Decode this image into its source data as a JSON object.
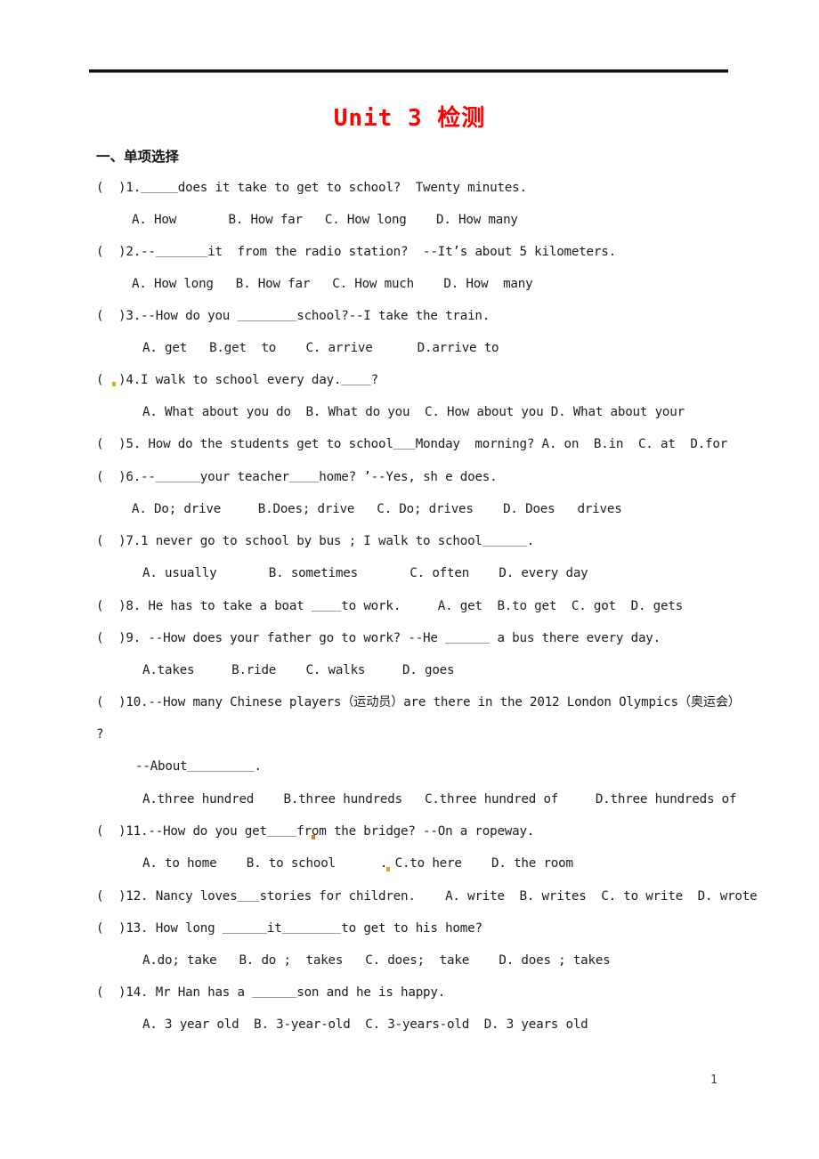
{
  "document": {
    "title": "Unit 3 检测",
    "title_color": "#ff0000",
    "page_number": "1",
    "section_heading": "一、单项选择"
  },
  "questions": [
    {
      "id": "q1",
      "stem": "（ ）1.＿＿＿does it take to get to school?  Twenty minutes.",
      "stem_prefix": "(  )1.",
      "stem_blank": "_____",
      "stem_rest": "does it take to get to school?  Twenty minutes.",
      "options_line": "A. How       B. How far   C. How long    D. How many"
    },
    {
      "id": "q2",
      "stem_prefix": "(  )2.--",
      "stem_blank": "_______",
      "stem_rest": "it  from the radio station?  --It’s about 5 kilometers.",
      "options_line": "A. How long   B. How far   C. How much    D. How  many"
    },
    {
      "id": "q3",
      "stem_prefix": "(  )3.--How do you ",
      "stem_blank": "________",
      "stem_rest": "school?--I take the train.",
      "options_line": "A. get   B.get  to    C. arrive      D.arrive to"
    },
    {
      "id": "q4",
      "stem_prefix": "(  )4.I walk to school every day.",
      "stem_blank": "____",
      "stem_rest": "?",
      "options_line": "A. What about you do  B. What do you  C. How about you D. What about your"
    },
    {
      "id": "q5",
      "stem_prefix": "(  )5. How do the students get to school",
      "stem_blank": "___",
      "stem_rest": "Monday  morning? A. on  B.in  C. at  D.for",
      "options_line": ""
    },
    {
      "id": "q6",
      "stem_prefix": "(  )6.--",
      "stem_blank": "______",
      "stem_rest": "your teacher",
      "stem_blank2": "____",
      "stem_rest2": "home? ’--Yes, sh e does.",
      "options_line": "A. Do; drive     B.Does; drive   C. Do; drives    D. Does   drives"
    },
    {
      "id": "q7",
      "stem_prefix": "(  )7.1 never go to school by bus ; I walk to school",
      "stem_blank": "______",
      "stem_rest": ".",
      "options_line": "A. usually       B. sometimes       C. often    D. every day"
    },
    {
      "id": "q8",
      "stem_prefix": "(  )8. He has to take a boat ",
      "stem_blank": "____",
      "stem_rest": "to work.     A. get  B.to get  C. got  D. gets",
      "options_line": ""
    },
    {
      "id": "q9",
      "stem_prefix": "(  )9. --How does your father go to work? --He ",
      "stem_blank": "______",
      "stem_rest": " a bus there every day.",
      "options_line": "A.takes     B.ride    C. walks     D. goes"
    },
    {
      "id": "q10",
      "stem_prefix": "(  )10.--How many Chinese players（运动员）are there in the 2012 London Olympics（奥运会）",
      "stem_blank": "",
      "stem_rest": "",
      "wrapped_line": "?",
      "answer_lead_prefix": "--About",
      "answer_lead_blank": "_________",
      "answer_lead_rest": ".",
      "options_line": "A.three hundred    B.three hundreds   C.three hundred of     D.three hundreds of"
    },
    {
      "id": "q11",
      "stem_prefix": "(  )11.--How do you get",
      "stem_blank": "____",
      "stem_rest": "from the bridge? --On a ropeway.",
      "options_line": "A. to home    B. to school      . C.to here    D. the room"
    },
    {
      "id": "q12",
      "stem_prefix": "(  )12. Nancy loves",
      "stem_blank": "___",
      "stem_rest": "stories for children.    A. write  B. writes  C. to write  D. wrote",
      "options_line": ""
    },
    {
      "id": "q13",
      "stem_prefix": "(  )13. How long ",
      "stem_blank": "______",
      "stem_rest": "it",
      "stem_blank2": "________",
      "stem_rest2": "to get to his home?",
      "options_line": "A.do; take   B. do ;  takes   C. does;  take    D. does ; takes"
    },
    {
      "id": "q14",
      "stem_prefix": "(  )14. Mr Han has a ",
      "stem_blank": "______",
      "stem_rest": "son and he is happy.",
      "options_line": "A. 3 year old  B. 3-year-old  C. 3-years-old  D. 3 years old"
    }
  ]
}
